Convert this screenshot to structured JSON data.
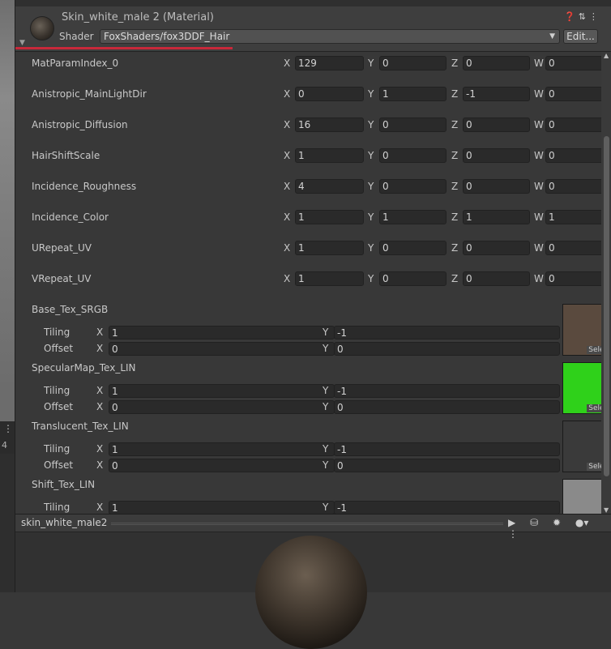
{
  "left_strip": {
    "text": "4"
  },
  "header": {
    "title": "Skin_white_male 2 (Material)",
    "shader_label": "Shader",
    "shader_value": "FoxShaders/fox3DDF_Hair",
    "edit_label": "Edit...",
    "icons": [
      "help-icon",
      "preset-icon",
      "more-icon"
    ]
  },
  "axes": {
    "x": "X",
    "y": "Y",
    "z": "Z",
    "w": "W"
  },
  "vectors": [
    {
      "label": "MatParamIndex_0",
      "x": "129",
      "y": "0",
      "z": "0",
      "w": "0"
    },
    {
      "label": "Anistropic_MainLightDir",
      "x": "0",
      "y": "1",
      "z": "-1",
      "w": "0"
    },
    {
      "label": "Anistropic_Diffusion",
      "x": "16",
      "y": "0",
      "z": "0",
      "w": "0"
    },
    {
      "label": "HairShiftScale",
      "x": "1",
      "y": "0",
      "z": "0",
      "w": "0"
    },
    {
      "label": "Incidence_Roughness",
      "x": "4",
      "y": "0",
      "z": "0",
      "w": "0"
    },
    {
      "label": "Incidence_Color",
      "x": "1",
      "y": "1",
      "z": "1",
      "w": "1"
    },
    {
      "label": "URepeat_UV",
      "x": "1",
      "y": "0",
      "z": "0",
      "w": "0"
    },
    {
      "label": "VRepeat_UV",
      "x": "1",
      "y": "0",
      "z": "0",
      "w": "0"
    }
  ],
  "textures": [
    {
      "name": "Base_Tex_SRGB",
      "tiling_label": "Tiling",
      "offset_label": "Offset",
      "tiling_x": "1",
      "tiling_y": "-1",
      "offset_x": "0",
      "offset_y": "0",
      "select": "Select",
      "thumb_color": "#5a4a3e"
    },
    {
      "name": "SpecularMap_Tex_LIN",
      "tiling_label": "Tiling",
      "offset_label": "Offset",
      "tiling_x": "1",
      "tiling_y": "-1",
      "offset_x": "0",
      "offset_y": "0",
      "select": "Select",
      "thumb_color": "#2fd11a"
    },
    {
      "name": "Translucent_Tex_LIN",
      "tiling_label": "Tiling",
      "offset_label": "Offset",
      "tiling_x": "1",
      "tiling_y": "-1",
      "offset_x": "0",
      "offset_y": "0",
      "select": "Select",
      "thumb_color": "#3a3a3a"
    },
    {
      "name": "Shift_Tex_LIN",
      "tiling_label": "Tiling",
      "tiling_x": "1",
      "tiling_y": "-1",
      "thumb_color": "#8a8a8a"
    }
  ],
  "preview": {
    "name": "skin_white_male2",
    "icons": [
      "play-icon",
      "cylinder-icon",
      "lights-icon",
      "sphere-icon"
    ]
  }
}
